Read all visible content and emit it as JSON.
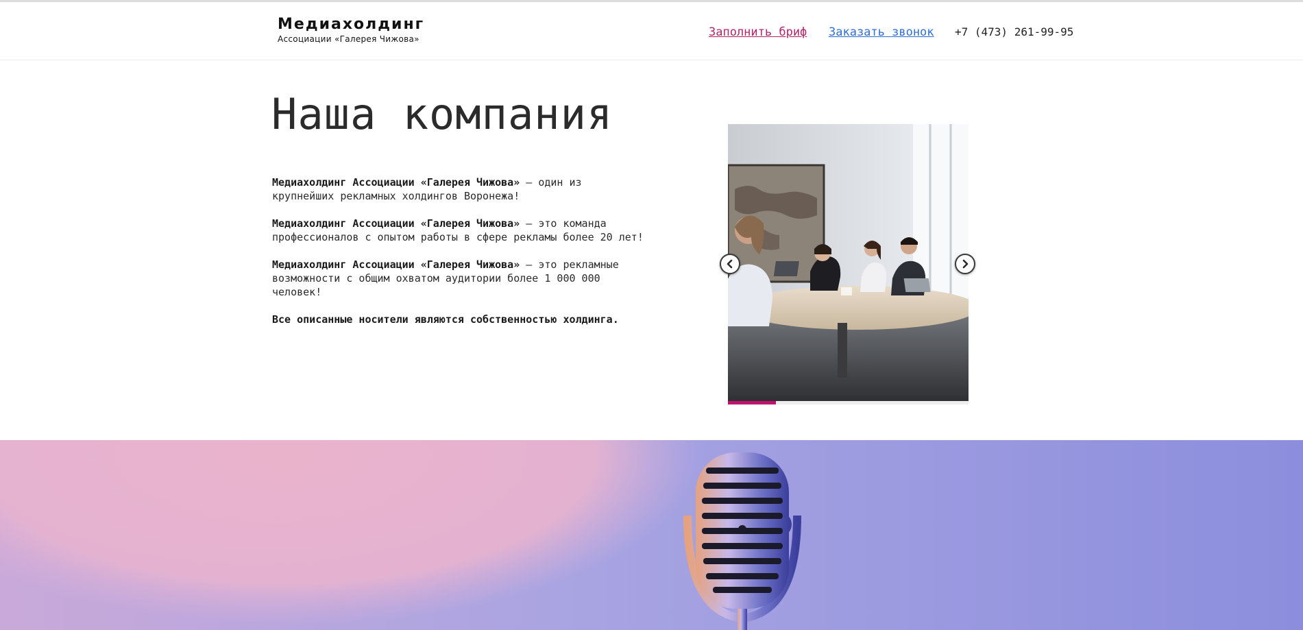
{
  "header": {
    "brand_title": "Медиахолдинг",
    "brand_subtitle": "Ассоциации «Галерея Чижова»",
    "nav_brief": "Заполнить бриф",
    "nav_call": "Заказать звонок",
    "phone": "+7 (473) 261-99-95"
  },
  "hero": {
    "title": "Наша компания",
    "paragraphs": [
      {
        "bold": "Медиахолдинг Ассоциации «Галерея Чижова»",
        "rest": " — один из крупнейших рекламных холдингов Воронежа!"
      },
      {
        "bold": "Медиахолдинг Ассоциации «Галерея Чижова»",
        "rest": " — это команда профессионалов с опытом работы в сфере рекламы более 20 лет!"
      },
      {
        "bold": "Медиахолдинг Ассоциации «Галерея Чижова»",
        "rest": " — это рекламные возможности с общим охватом аудитории более 1 000 000 человек!"
      }
    ],
    "closing": "Все описанные носители являются собственностью холдинга."
  },
  "slider": {
    "image": "office-meeting-photo",
    "progress": 0.2,
    "prev_icon": "chevron-left-icon",
    "next_icon": "chevron-right-icon"
  },
  "banner": {
    "image": "retro-microphone-photo"
  },
  "colors": {
    "accent": "#c2126f",
    "link_brief": "#b3246d",
    "link_call": "#2f6fd8"
  }
}
